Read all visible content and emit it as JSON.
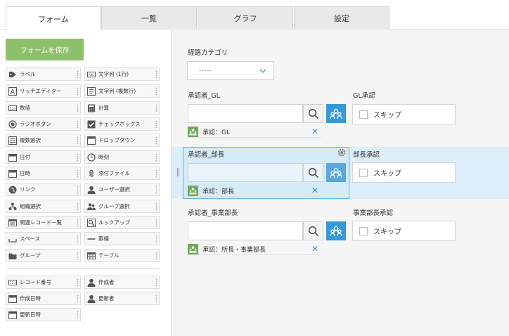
{
  "tabs": [
    {
      "label": "フォーム"
    },
    {
      "label": "一覧"
    },
    {
      "label": "グラフ"
    },
    {
      "label": "設定"
    }
  ],
  "palette": {
    "save_label": "フォームを保存",
    "fields": [
      {
        "label": "ラベル",
        "icon": "label-icon"
      },
      {
        "label": "文字列 (1行)",
        "icon": "text-single-icon"
      },
      {
        "label": "リッチエディター",
        "icon": "rich-editor-icon"
      },
      {
        "label": "文字列 (複数行)",
        "icon": "text-multi-icon"
      },
      {
        "label": "数値",
        "icon": "number-icon"
      },
      {
        "label": "計算",
        "icon": "calculator-icon"
      },
      {
        "label": "ラジオボタン",
        "icon": "radio-icon"
      },
      {
        "label": "チェックボックス",
        "icon": "checkbox-icon"
      },
      {
        "label": "複数選択",
        "icon": "multi-select-icon"
      },
      {
        "label": "ドロップダウン",
        "icon": "dropdown-icon"
      },
      {
        "label": "日付",
        "icon": "calendar-icon"
      },
      {
        "label": "時刻",
        "icon": "clock-icon"
      },
      {
        "label": "日時",
        "icon": "datetime-icon"
      },
      {
        "label": "添付ファイル",
        "icon": "paperclip-icon"
      },
      {
        "label": "リンク",
        "icon": "globe-icon"
      },
      {
        "label": "ユーザー選択",
        "icon": "user-icon"
      },
      {
        "label": "組織選択",
        "icon": "org-icon"
      },
      {
        "label": "グループ選択",
        "icon": "group-icon"
      },
      {
        "label": "関連レコード一覧",
        "icon": "related-records-icon"
      },
      {
        "label": "ルックアップ",
        "icon": "lookup-icon"
      },
      {
        "label": "スペース",
        "icon": "space-icon"
      },
      {
        "label": "罫線",
        "icon": "line-icon"
      },
      {
        "label": "グループ",
        "icon": "folder-icon"
      },
      {
        "label": "テーブル",
        "icon": "table-icon"
      }
    ],
    "system_fields": [
      {
        "label": "レコード番号",
        "icon": "record-number-icon"
      },
      {
        "label": "作成者",
        "icon": "user-icon"
      },
      {
        "label": "作成日時",
        "icon": "calendar-icon"
      },
      {
        "label": "更新者",
        "icon": "user-icon"
      },
      {
        "label": "更新日時",
        "icon": "calendar-icon"
      }
    ]
  },
  "form": {
    "category_label": "経路カテゴリ",
    "category_value": "-----",
    "rows": [
      {
        "approver_label": "承認者_GL",
        "chip": "承認：GL",
        "skip_label": "GL承認",
        "skip_text": "スキップ"
      },
      {
        "approver_label": "承認者_部長",
        "chip": "承認：部長",
        "skip_label": "部長承認",
        "skip_text": "スキップ"
      },
      {
        "approver_label": "承認者_事業部長",
        "chip": "承認：所長・事業部長",
        "skip_label": "事業部長承認",
        "skip_text": "スキップ"
      }
    ]
  },
  "colors": {
    "accent": "#3498db",
    "save_button": "#8dc06b",
    "chip_icon": "#6ea95a",
    "selected": "#5ab6e8"
  }
}
